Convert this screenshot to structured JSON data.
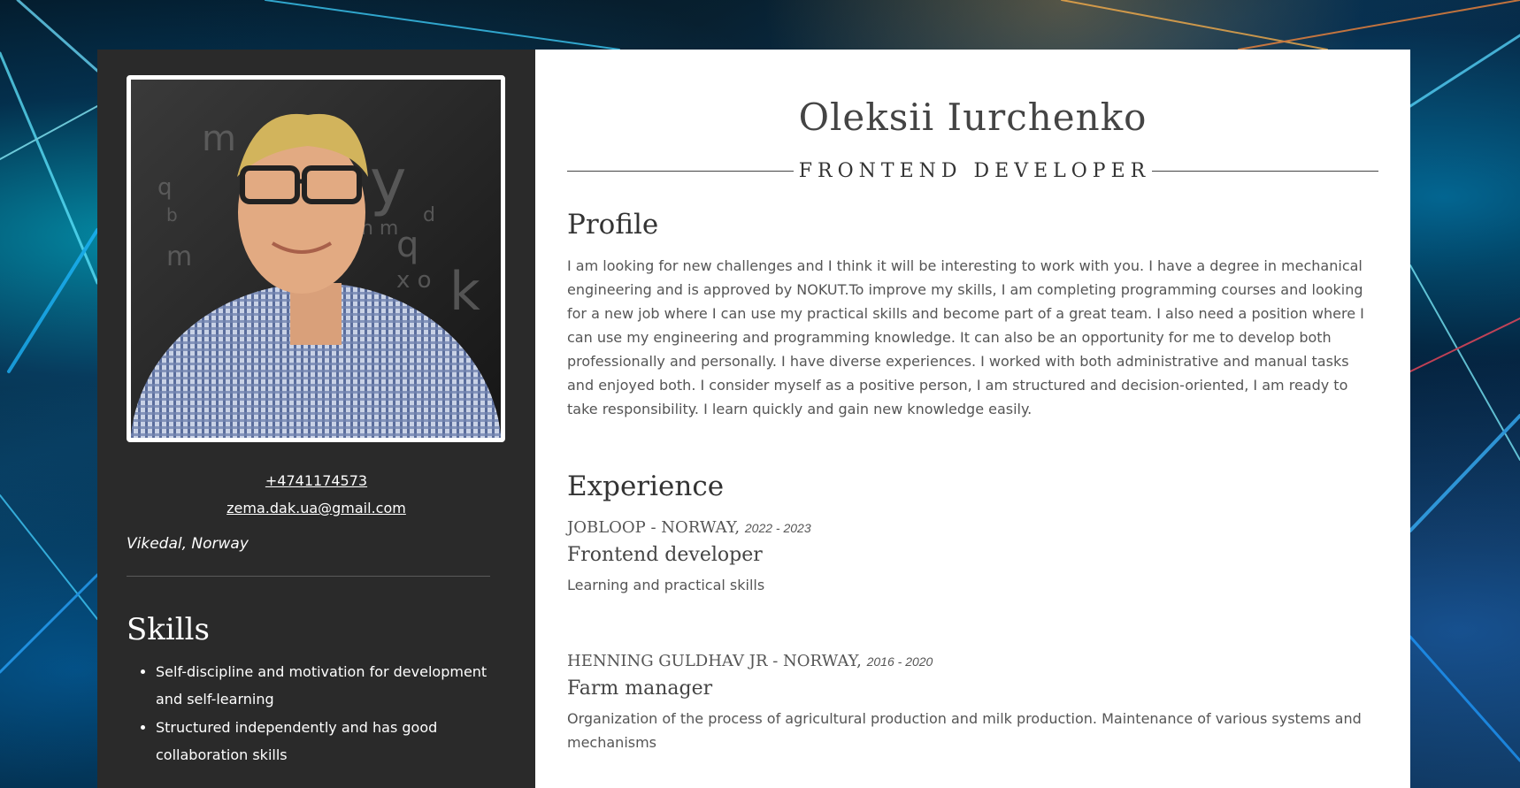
{
  "sidebar": {
    "phone": "+4741174573",
    "email": "zema.dak.ua@gmail.com",
    "location": "Vikedal, Norway",
    "skills_title": "Skills",
    "skills": [
      "Self-discipline and motivation for development and self-learning",
      "Structured independently and has good collaboration skills"
    ]
  },
  "main": {
    "name": "Oleksii Iurchenko",
    "role": "FRONTEND DEVELOPER",
    "profile_title": "Profile",
    "profile_text": "I am looking for new challenges and I think it will be interesting to work with you. I have a degree in mechanical engineering and is approved by NOKUT.To improve my skills, I am completing programming courses and looking for a new job where I can use my practical skills and become part of a great team. I also need a position where I can use my engineering and programming knowledge. It can also be an opportunity for me to develop both professionally and personally. I have diverse experiences. I worked with both administrative and manual tasks and enjoyed both. I consider myself as a positive person, I am structured and decision-oriented, I am ready to take responsibility. I learn quickly and gain new knowledge easily.",
    "experience_title": "Experience",
    "jobs": [
      {
        "company": "JOBLOOP - NORWAY,",
        "years": "2022 - 2023",
        "title": "Frontend developer",
        "description": "Learning and practical skills"
      },
      {
        "company": "HENNING GULDHAV JR - NORWAY,",
        "years": "2016 - 2020",
        "title": "Farm manager",
        "description": "Organization of the process of agricultural production and milk production. Maintenance of various systems and mechanisms"
      }
    ]
  },
  "icons": {
    "profile_photo": "profile-photo"
  }
}
